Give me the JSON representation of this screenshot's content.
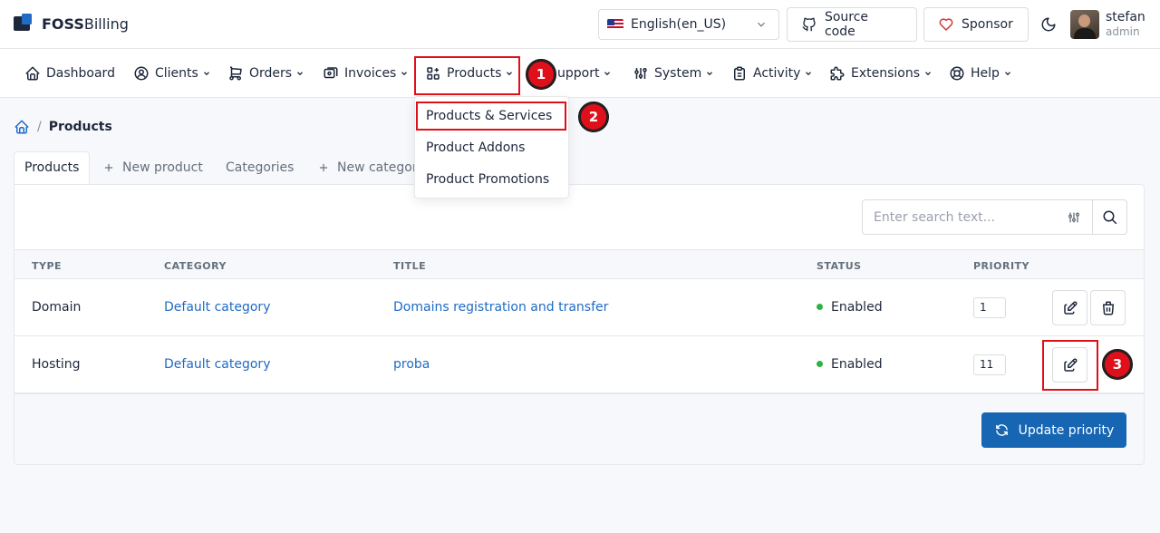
{
  "app": {
    "brand_bold": "FOSS",
    "brand_rest": "Billing"
  },
  "header": {
    "language": "English(en_US)",
    "source_code_label": "Source code",
    "sponsor_label": "Sponsor",
    "user_name": "stefan",
    "user_role": "admin"
  },
  "nav": {
    "items": [
      {
        "label": "Dashboard",
        "icon": "home-icon"
      },
      {
        "label": "Clients",
        "icon": "user-circle-icon"
      },
      {
        "label": "Orders",
        "icon": "cart-icon"
      },
      {
        "label": "Invoices",
        "icon": "receipt-icon"
      },
      {
        "label": "Products",
        "icon": "apps-icon"
      },
      {
        "label": "Support",
        "icon": "lifebuoy-icon"
      },
      {
        "label": "System",
        "icon": "adjustments-icon"
      },
      {
        "label": "Activity",
        "icon": "clipboard-icon"
      },
      {
        "label": "Extensions",
        "icon": "puzzle-icon"
      },
      {
        "label": "Help",
        "icon": "help-icon"
      }
    ],
    "support_visible": "upport"
  },
  "products_menu": [
    "Products & Services",
    "Product Addons",
    "Product Promotions"
  ],
  "annotations": [
    "1",
    "2",
    "3"
  ],
  "breadcrumb": {
    "current": "Products"
  },
  "tabs": {
    "products": "Products",
    "new_product": "New product",
    "categories": "Categories",
    "new_category": "New categor"
  },
  "search": {
    "placeholder": "Enter search text..."
  },
  "table": {
    "headers": [
      "TYPE",
      "CATEGORY",
      "TITLE",
      "STATUS",
      "PRIORITY"
    ],
    "rows": [
      {
        "type": "Domain",
        "category": "Default category",
        "title": "Domains registration and transfer",
        "status": "Enabled",
        "priority": "1"
      },
      {
        "type": "Hosting",
        "category": "Default category",
        "title": "proba",
        "status": "Enabled",
        "priority": "11"
      }
    ]
  },
  "footer": {
    "update_label": "Update priority"
  },
  "colors": {
    "accent": "#1766b3",
    "link": "#206bc4",
    "status_enabled": "#2fb344",
    "annotation_red": "#e0101b"
  }
}
